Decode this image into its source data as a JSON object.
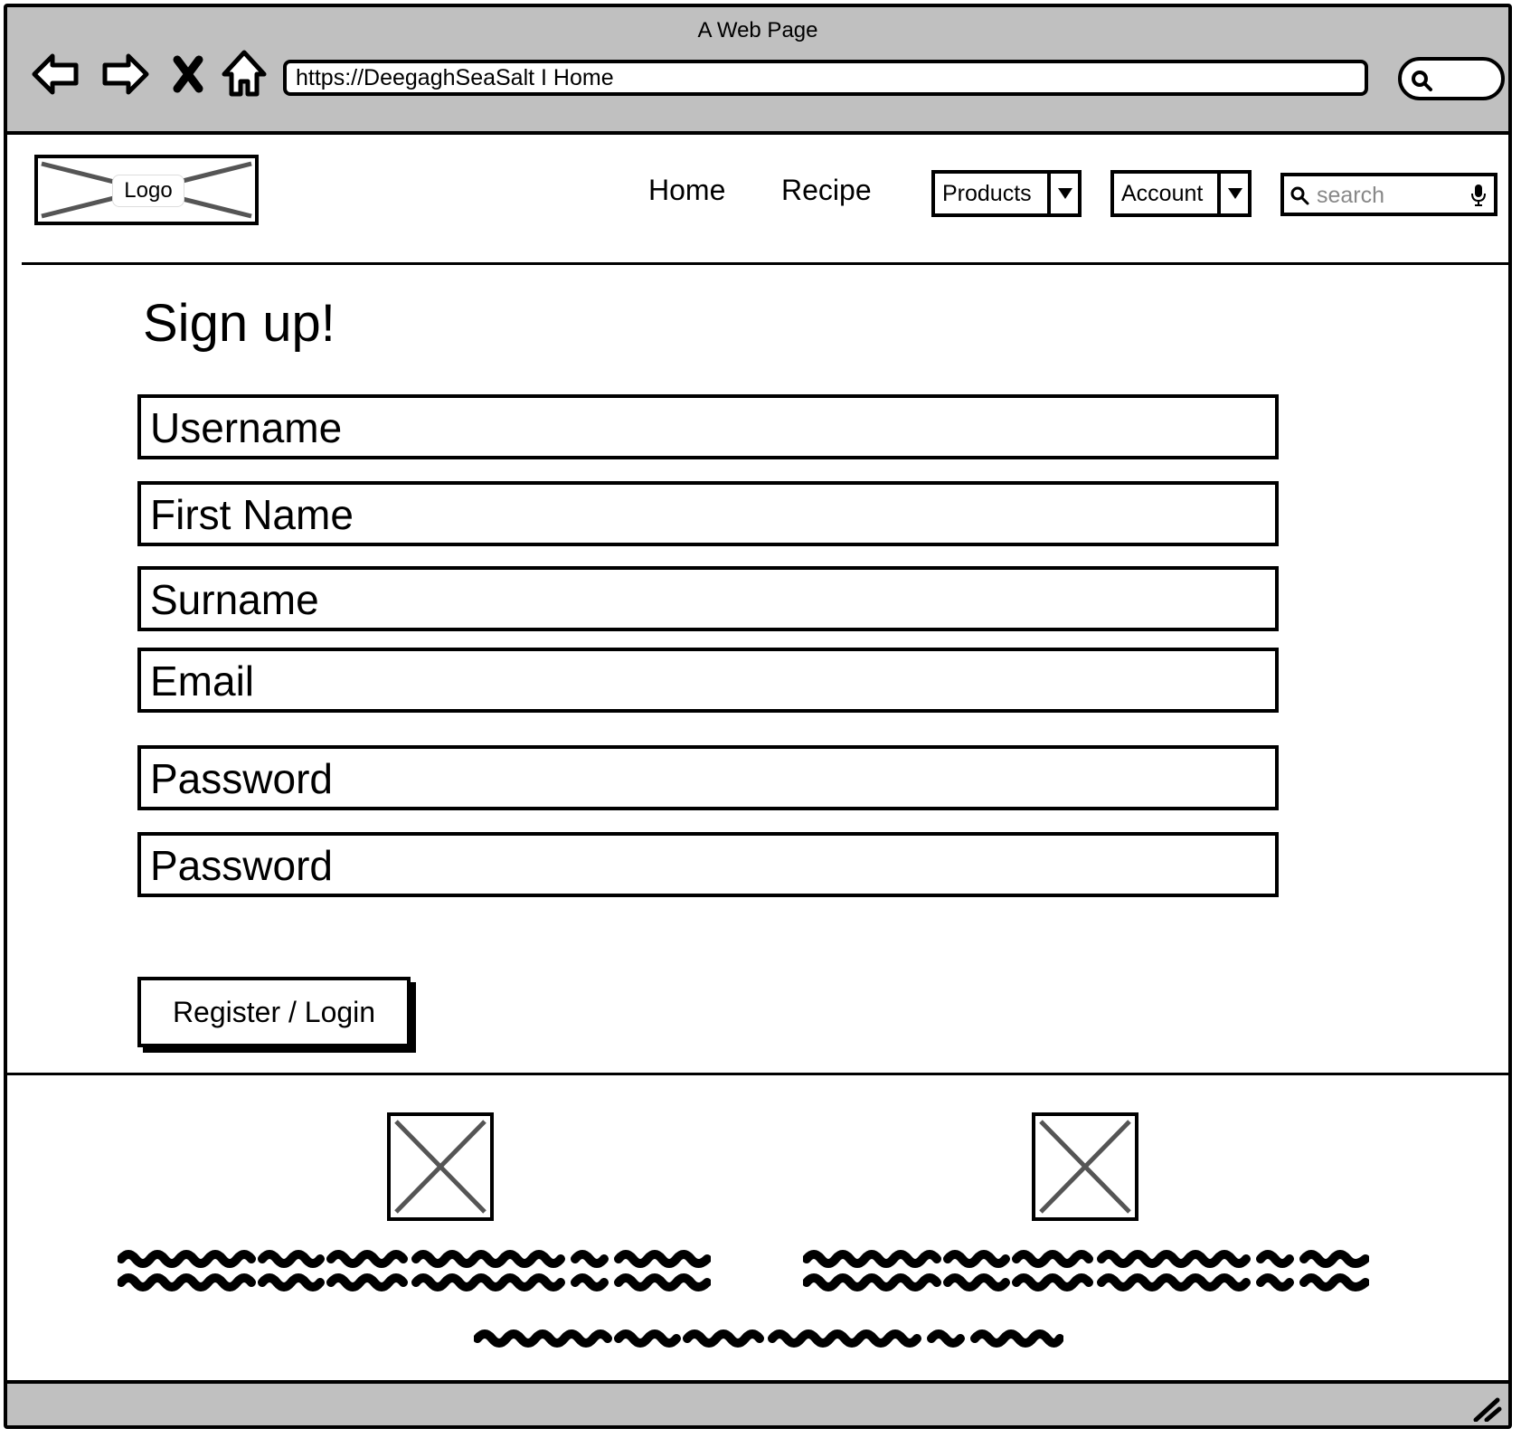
{
  "window": {
    "title": "A Web Page"
  },
  "browser": {
    "address": "https://DeegaghSeaSalt I Home",
    "icons": [
      "back-arrow-icon",
      "forward-arrow-icon",
      "close-icon",
      "home-icon",
      "search-icon"
    ]
  },
  "header": {
    "logo_label": "Logo",
    "nav": [
      {
        "label": "Home"
      },
      {
        "label": "Recipe"
      }
    ],
    "products_label": "Products",
    "account_label": "Account",
    "search_placeholder": "search"
  },
  "form": {
    "title": "Sign up!",
    "fields": [
      {
        "placeholder": "Username"
      },
      {
        "placeholder": "First Name"
      },
      {
        "placeholder": "Surname"
      },
      {
        "placeholder": "Email"
      },
      {
        "placeholder": "Password"
      },
      {
        "placeholder": "Password"
      }
    ],
    "submit_label": "Register / Login"
  },
  "colors": {
    "chrome": "#c0c0c0",
    "border": "#000000",
    "placeholder_grey": "#888888"
  }
}
